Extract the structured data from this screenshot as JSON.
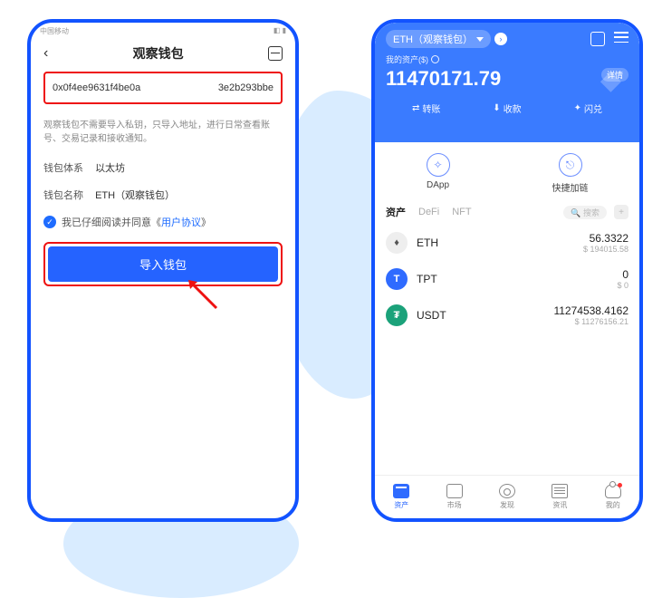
{
  "left": {
    "status": "中国移动",
    "title": "观察钱包",
    "address_left": "0x0f4ee9631f4be0a",
    "address_right": "3e2b293bbe",
    "description": "观察钱包不需要导入私钥，只导入地址，进行日常查看账号、交易记录和接收通知。",
    "system_label": "钱包体系",
    "system_value": "以太坊",
    "name_label": "钱包名称",
    "name_value": "ETH（观察钱包）",
    "agree_prefix": "我已仔细阅读并同意《",
    "agree_link": "用户协议",
    "agree_suffix": "》",
    "import_btn": "导入钱包"
  },
  "right": {
    "chain": "ETH（观察钱包）",
    "assets_label": "我的资产($)",
    "assets_amount": "11470171.79",
    "detail": "详情",
    "actions": {
      "transfer": "转账",
      "receive": "收款",
      "swap": "闪兑"
    },
    "quick": {
      "dapp": "DApp",
      "chain": "快捷加链"
    },
    "tabs": {
      "asset": "资产",
      "defi": "DeFi",
      "nft": "NFT"
    },
    "search_placeholder": "搜索",
    "tokens": [
      {
        "sym": "ETH",
        "amt": "56.3322",
        "fiat": "$ 194015.58"
      },
      {
        "sym": "TPT",
        "amt": "0",
        "fiat": "$ 0"
      },
      {
        "sym": "USDT",
        "amt": "11274538.4162",
        "fiat": "$ 11276156.21"
      }
    ],
    "nav": {
      "asset": "资产",
      "market": "市场",
      "discover": "发现",
      "news": "资讯",
      "me": "我的"
    }
  }
}
